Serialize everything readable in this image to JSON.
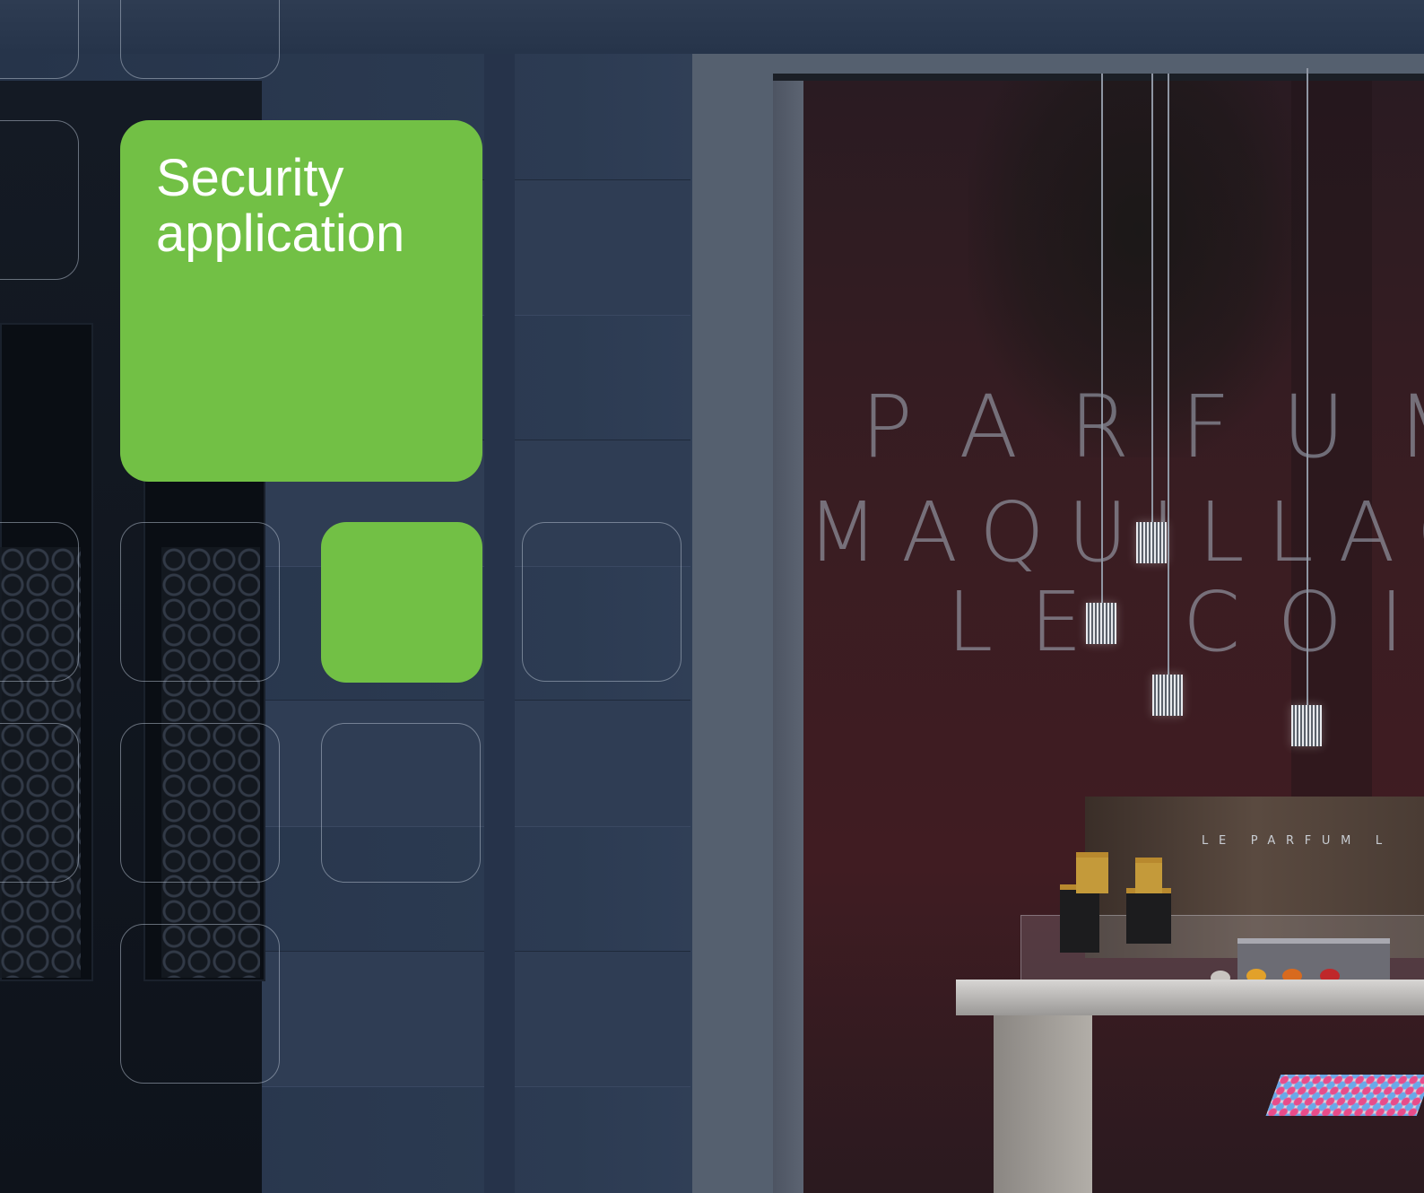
{
  "hero": {
    "title": "Security application"
  },
  "storefront": {
    "window_lines": [
      "PARFUM",
      "MAQUILLAGE",
      "LE COIN"
    ],
    "display_label": "LE PARFUM L"
  },
  "colors": {
    "accent_green": "#72c045",
    "tile_outline": "#afb9c8",
    "background_wall": "#2c3b52"
  }
}
